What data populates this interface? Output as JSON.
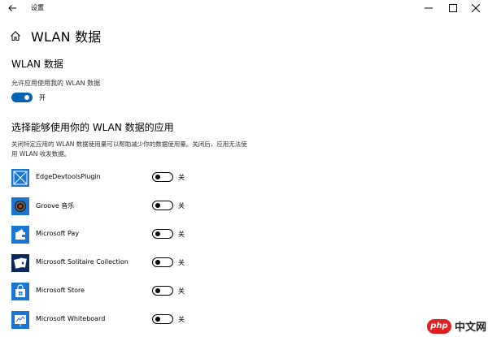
{
  "window": {
    "title": "设置",
    "controls": {
      "minimize_icon": "minimize-icon",
      "maximize_icon": "maximize-icon",
      "close_icon": "close-icon"
    }
  },
  "header": {
    "home_icon": "home-icon",
    "title": "WLAN 数据"
  },
  "section_wlan": {
    "title": "WLAN 数据",
    "allow_label": "允许应用使用我的 WLAN 数据",
    "toggle_on": true,
    "toggle_state": "开"
  },
  "section_apps": {
    "title": "选择能够使用你的 WLAN 数据的应用",
    "description": "关闭特定应用的 WLAN 数据使用量可以帮助减少你的数据使用量。关闭后，应用无法使用 WLAN 收发数据。",
    "apps": [
      {
        "name": "EdgeDevtoolsPlugin",
        "icon": "edge-devtools-icon",
        "state": "关",
        "on": false
      },
      {
        "name": "Groove 音乐",
        "icon": "groove-music-icon",
        "state": "关",
        "on": false
      },
      {
        "name": "Microsoft Pay",
        "icon": "wallet-icon",
        "state": "关",
        "on": false
      },
      {
        "name": "Microsoft Solitaire Collection",
        "icon": "cards-icon",
        "state": "关",
        "on": false
      },
      {
        "name": "Microsoft Store",
        "icon": "store-bag-icon",
        "state": "关",
        "on": false
      },
      {
        "name": "Microsoft Whiteboard",
        "icon": "whiteboard-icon",
        "state": "关",
        "on": false
      }
    ]
  },
  "watermark": {
    "logo": "php",
    "text": "中文网"
  },
  "colors": {
    "accent": "#0063b1",
    "app_tile": "#1976d2",
    "solitaire_tile": "#0a2a5c",
    "watermark": "#e02020"
  }
}
